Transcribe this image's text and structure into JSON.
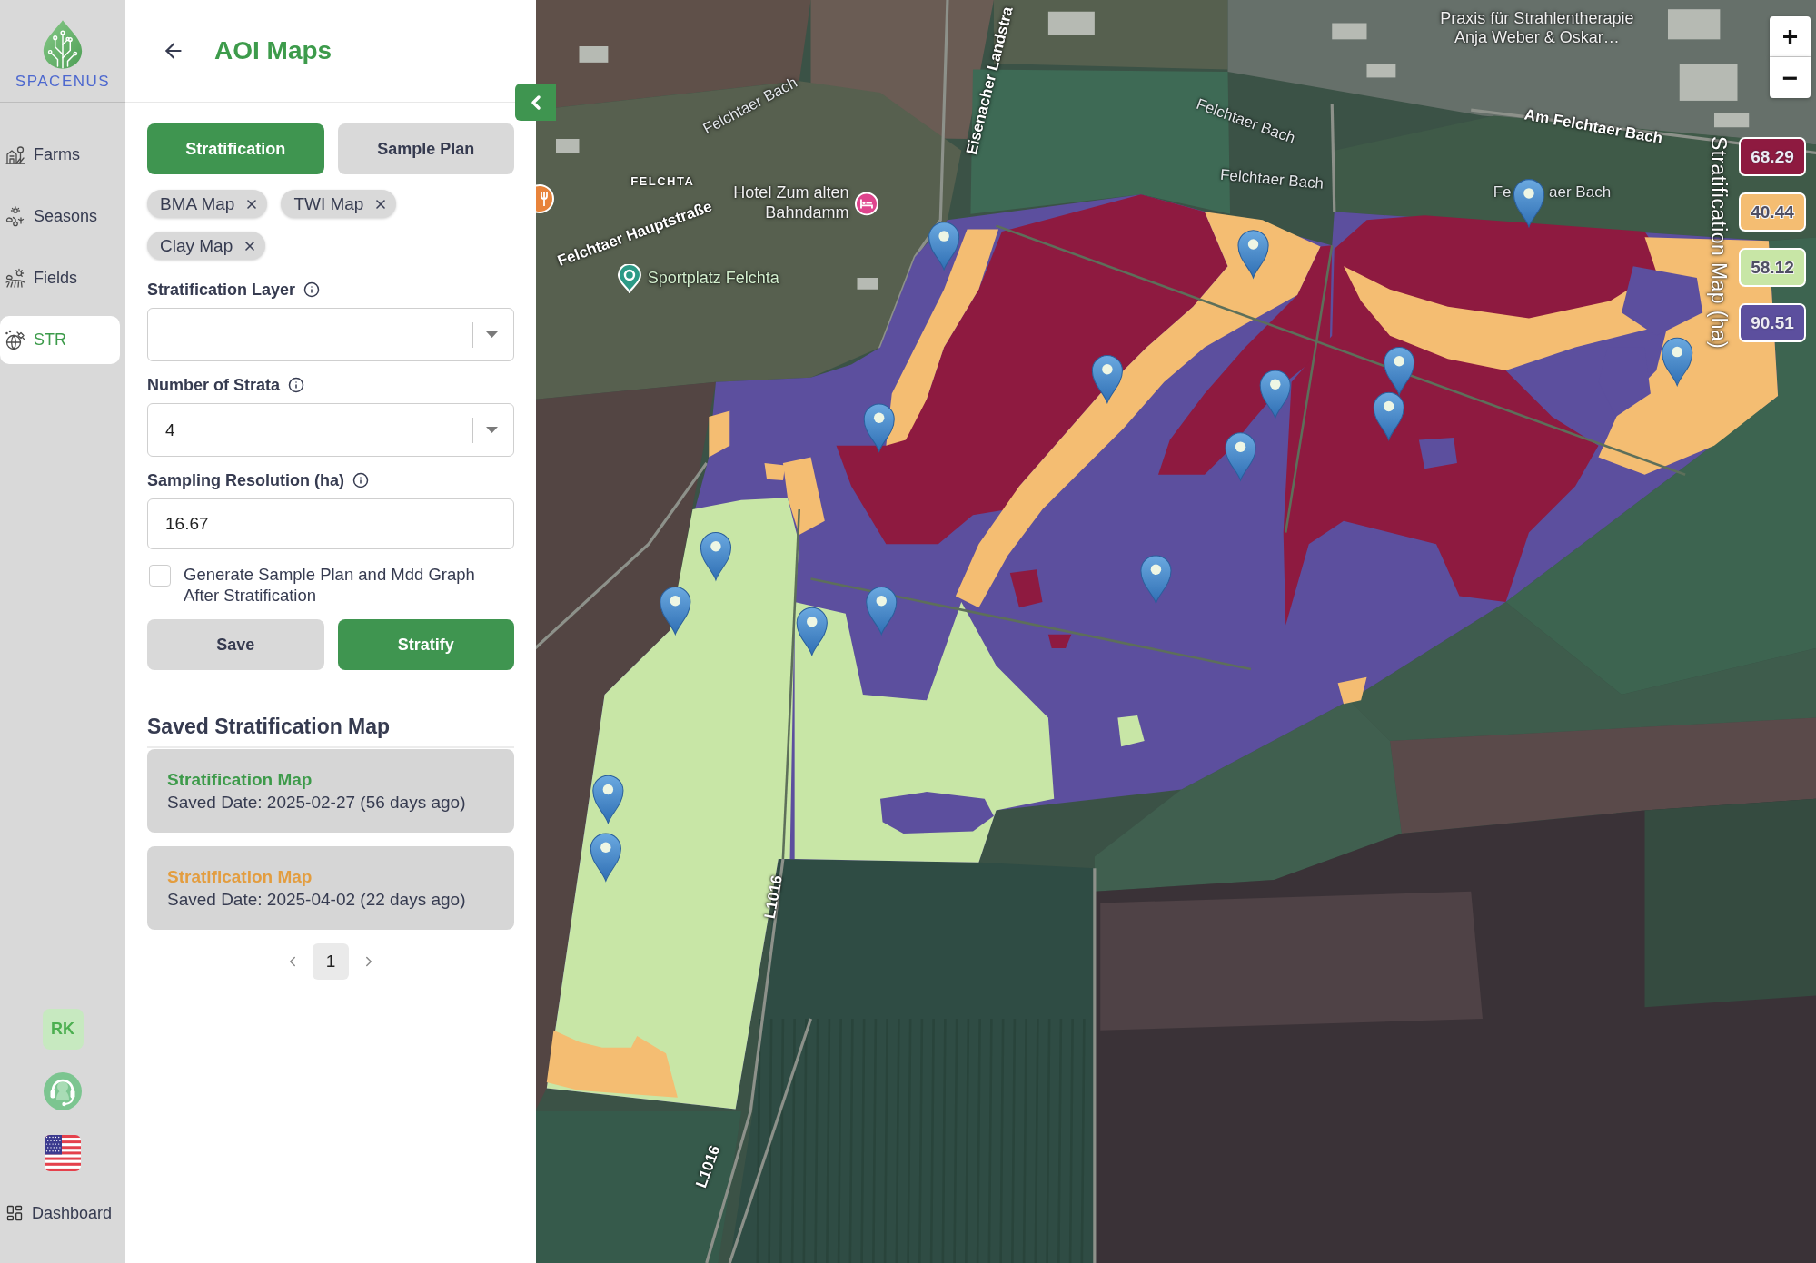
{
  "nav": {
    "logo": "SPACENUS",
    "items": [
      {
        "kind": "farms",
        "label": "Farms",
        "selected": false
      },
      {
        "kind": "seasons",
        "label": "Seasons",
        "selected": false
      },
      {
        "kind": "fields",
        "label": "Fields",
        "selected": false
      },
      {
        "kind": "str",
        "label": "STR",
        "selected": true
      }
    ],
    "avatar": "RK",
    "footer": "Dashboard"
  },
  "panel": {
    "title": "AOI Maps",
    "tabs": [
      {
        "label": "Stratification",
        "selected": true
      },
      {
        "label": "Sample Plan",
        "selected": false
      }
    ],
    "layer_chips": [
      {
        "label": "BMA Map"
      },
      {
        "label": "TWI Map"
      },
      {
        "label": "Clay Map"
      }
    ],
    "fields": [
      {
        "kind": "select",
        "label": "Stratification Layer"
      },
      {
        "kind": "select",
        "label": "Number of Strata",
        "value": "4"
      },
      {
        "kind": "input",
        "label": "Sampling Resolution (ha)",
        "value": "16.67"
      }
    ],
    "checkbox": {
      "label": "Generate Sample Plan and Mdd Graph After Stratification",
      "checked": false
    },
    "actions": [
      {
        "kind": "secondary",
        "label": "Save"
      },
      {
        "kind": "primary",
        "label": "Stratify"
      }
    ],
    "saved": {
      "heading": "Saved Stratification Map",
      "maps": [
        {
          "title": "Stratification Map",
          "color": "#3d9a4a",
          "date": "Saved Date: 2025-02-27 (56 days ago)"
        },
        {
          "title": "Stratification Map",
          "color": "#e39d3f",
          "date": "Saved Date: 2025-04-02 (22 days ago)"
        }
      ]
    },
    "pages": [
      {
        "label": "1",
        "selected": true
      }
    ]
  },
  "map": {
    "labels": [
      {
        "kind": "clinic",
        "lines": [
          "Praxis für Strahlentherapie",
          "Anja Weber & Oskar…"
        ]
      },
      {
        "kind": "water",
        "lines": [
          "Felchtaer Bach"
        ]
      },
      {
        "kind": "road",
        "lines": [
          "Eisenacher Landstra"
        ]
      },
      {
        "kind": "water",
        "lines": [
          "Felchtaer Bach"
        ]
      },
      {
        "kind": "water",
        "lines": [
          "Felchtaer Bach"
        ]
      },
      {
        "kind": "road",
        "lines": [
          "Am Felchtaer Bach"
        ]
      },
      {
        "kind": "water",
        "lines": [
          "Fe"
        ]
      },
      {
        "kind": "water",
        "lines": [
          "aer Bach"
        ]
      },
      {
        "kind": "place",
        "lines": [
          "FELCHTA"
        ]
      },
      {
        "kind": "hotel",
        "lines": [
          "Hotel Zum alten",
          "Bahndamm"
        ]
      },
      {
        "kind": "road",
        "lines": [
          "Felchtaer Hauptstraße"
        ]
      },
      {
        "kind": "sport",
        "lines": [
          "Sportplatz Felchta"
        ]
      },
      {
        "kind": "restaurant"
      },
      {
        "kind": "road",
        "lines": [
          "L1016"
        ]
      },
      {
        "kind": "road",
        "lines": [
          "L1016"
        ]
      }
    ],
    "legend": {
      "title": "Stratification Map (ha)",
      "items": [
        {
          "value": "68.29",
          "color": "#8e1a40"
        },
        {
          "value": "40.44",
          "color": "#f4bd72"
        },
        {
          "value": "58.12",
          "color": "#c8e6a6"
        },
        {
          "value": "90.51",
          "color": "#5c4f9e"
        }
      ]
    },
    "zoom_controls": [
      {
        "label": "+"
      },
      {
        "label": "−"
      }
    ]
  }
}
